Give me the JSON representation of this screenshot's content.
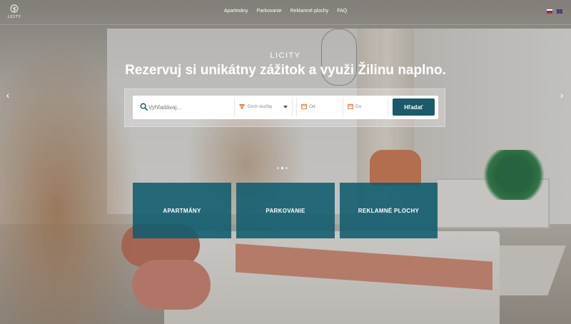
{
  "logo": {
    "text": "LICITY"
  },
  "nav": {
    "items": [
      {
        "label": "Apartmány"
      },
      {
        "label": "Parkovanie"
      },
      {
        "label": "Reklamné plochy"
      },
      {
        "label": "FAQ"
      }
    ]
  },
  "languages": [
    {
      "code": "sk",
      "icon": "flag-slovakia-icon"
    },
    {
      "code": "en",
      "icon": "flag-uk-icon"
    }
  ],
  "hero": {
    "brand": "LICITY",
    "headline": "Rezervuj si unikátny zážitok a využi Žilinu naplno."
  },
  "search": {
    "placeholder": "Vyhľadávaj...",
    "service_placeholder": "Druh služby",
    "from_placeholder": "Od",
    "to_placeholder": "Do",
    "button_label": "Hľadať"
  },
  "carousel": {
    "slides": 3,
    "active": 1
  },
  "categories": [
    {
      "label": "APARTMÁNY"
    },
    {
      "label": "PARKOVANIE"
    },
    {
      "label": "REKLAMNÉ PLOCHY"
    }
  ],
  "colors": {
    "accent": "#1b5a69",
    "card": "#0f5c6e",
    "icon_orange": "#e0793c"
  }
}
